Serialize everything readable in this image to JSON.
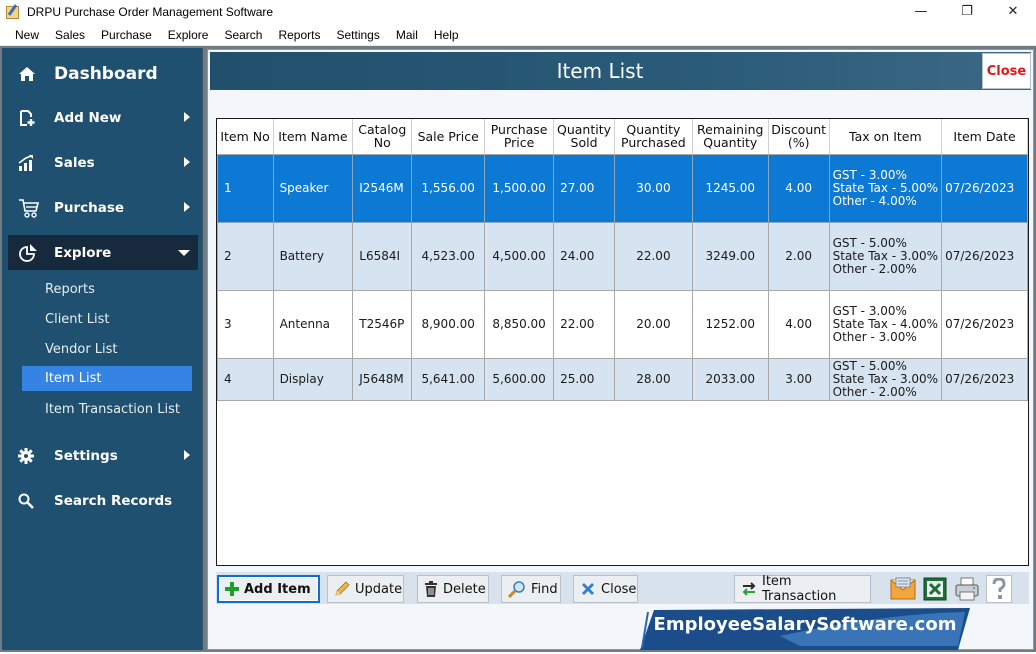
{
  "window": {
    "title": "DRPU Purchase Order Management Software",
    "controls": {
      "minimize": "—",
      "restore": "❐",
      "close": "✕"
    }
  },
  "menubar": [
    "New",
    "Sales",
    "Purchase",
    "Explore",
    "Search",
    "Reports",
    "Settings",
    "Mail",
    "Help"
  ],
  "sidebar": {
    "dashboard": {
      "label": "Dashboard",
      "icon": "home-icon"
    },
    "main_items": [
      {
        "label": "Add New",
        "icon": "add-document-icon",
        "has_arrow": true
      },
      {
        "label": "Sales",
        "icon": "sales-chart-icon",
        "has_arrow": true
      },
      {
        "label": "Purchase",
        "icon": "cart-icon",
        "has_arrow": true
      },
      {
        "label": "Explore",
        "icon": "pie-chart-icon",
        "expanded": true
      }
    ],
    "explore_sub": [
      "Reports",
      "Client List",
      "Vendor List",
      "Item List",
      "Item Transaction List"
    ],
    "active_sub": "Item List",
    "bottom_items": [
      {
        "label": "Settings",
        "icon": "gear-icon",
        "has_arrow": true
      },
      {
        "label": "Search Records",
        "icon": "search-icon"
      }
    ]
  },
  "content": {
    "title": "Item List",
    "close_label": "Close"
  },
  "table": {
    "columns": [
      "Item No",
      "Item Name",
      "Catalog No",
      "Sale Price",
      "Purchase Price",
      "Quantity Sold",
      "Quantity Purchased",
      "Remaining Quantity",
      "Discount (%)",
      "Tax on Item",
      "Item Date"
    ],
    "column_lines": [
      [
        "Item No"
      ],
      [
        "Item Name"
      ],
      [
        "Catalog",
        "No"
      ],
      [
        "Sale Price"
      ],
      [
        "Purchase",
        "Price"
      ],
      [
        "Quantity",
        "Sold"
      ],
      [
        "Quantity",
        "Purchased"
      ],
      [
        "Remaining",
        "Quantity"
      ],
      [
        "Discount",
        "(%)"
      ],
      [
        "Tax on Item"
      ],
      [
        "Item Date"
      ]
    ],
    "selected_row": 0,
    "rows": [
      {
        "item_no": "1",
        "item_name": "Speaker",
        "catalog_no": "I2546M",
        "sale_price": "1,556.00",
        "purchase_price": "1,500.00",
        "qty_sold": "27.00",
        "qty_purchased": "30.00",
        "remaining_qty": "1245.00",
        "discount": "4.00",
        "tax": [
          "GST - 3.00%",
          "State Tax - 5.00%",
          "Other - 4.00%"
        ],
        "date": "07/26/2023"
      },
      {
        "item_no": "2",
        "item_name": "Battery",
        "catalog_no": "L6584I",
        "sale_price": "4,523.00",
        "purchase_price": "4,500.00",
        "qty_sold": "24.00",
        "qty_purchased": "22.00",
        "remaining_qty": "3249.00",
        "discount": "2.00",
        "tax": [
          "GST - 5.00%",
          "State Tax - 3.00%",
          "Other - 2.00%"
        ],
        "date": "07/26/2023"
      },
      {
        "item_no": "3",
        "item_name": "Antenna",
        "catalog_no": "T2546P",
        "sale_price": "8,900.00",
        "purchase_price": "8,850.00",
        "qty_sold": "22.00",
        "qty_purchased": "20.00",
        "remaining_qty": "1252.00",
        "discount": "4.00",
        "tax": [
          "GST - 3.00%",
          "State Tax - 4.00%",
          "Other - 3.00%"
        ],
        "date": "07/26/2023"
      },
      {
        "item_no": "4",
        "item_name": "Display",
        "catalog_no": "J5648M",
        "sale_price": "5,641.00",
        "purchase_price": "5,600.00",
        "qty_sold": "25.00",
        "qty_purchased": "28.00",
        "remaining_qty": "2033.00",
        "discount": "3.00",
        "tax": [
          "GST - 5.00%",
          "State Tax - 3.00%",
          "Other - 2.00%"
        ],
        "date": "07/26/2023"
      }
    ]
  },
  "buttons": {
    "add_item": "Add Item",
    "update": "Update",
    "delete": "Delete",
    "find": "Find",
    "close": "Close",
    "item_transaction": "Item Transaction",
    "icon_buttons": [
      "mail-icon",
      "excel-icon",
      "printer-icon",
      "help-icon"
    ]
  },
  "banner": {
    "text": "EmployeeSalarySoftware.com"
  },
  "colors": {
    "sidebar_bg": "#1f506f",
    "sidebar_expanded_bg": "#172a3d",
    "sidebar_active_sub": "#3584e4",
    "header_bg": "#21506c",
    "selected_row": "#0c79d4",
    "alt_row": "#d6e4f1",
    "close_red": "#e2161b"
  }
}
